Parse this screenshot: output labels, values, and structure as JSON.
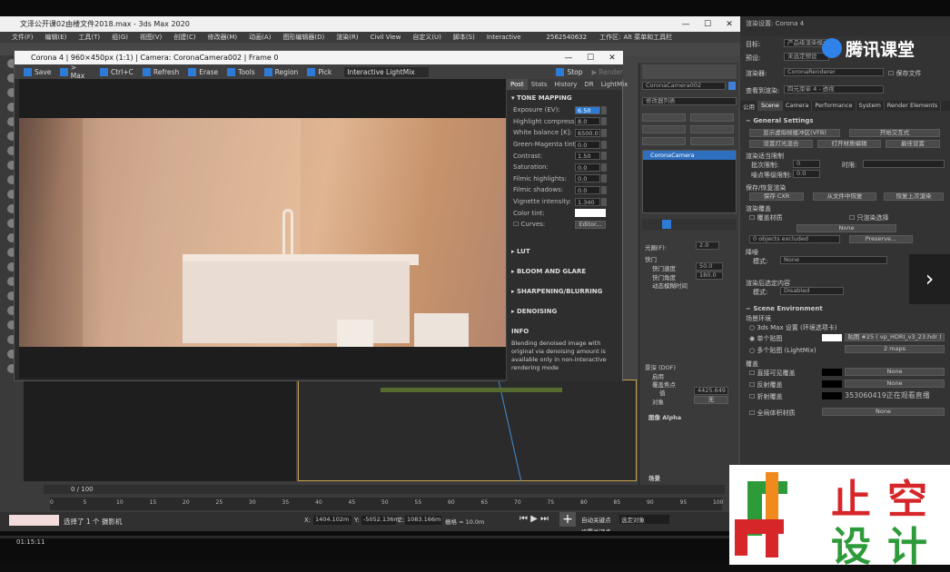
{
  "max": {
    "title": "文泽公开课02由楼文件2018.max - 3ds Max 2020",
    "menu": [
      "文件(F)",
      "编辑(E)",
      "工具(T)",
      "组(G)",
      "视图(V)",
      "创建(C)",
      "修改器(M)",
      "动画(A)",
      "图形编辑器(D)",
      "渲染(R)",
      "Civil View",
      "自定义(U)",
      "脚本(S)",
      "Interactive"
    ],
    "user": "2562540632",
    "workspace_label": "工作区:",
    "workspace_value": "Alt 菜单和工具栏",
    "time_slider": "0 / 100",
    "ticks": [
      "0",
      "5",
      "10",
      "15",
      "20",
      "25",
      "30",
      "35",
      "40",
      "45",
      "50",
      "55",
      "60",
      "65",
      "70",
      "75",
      "80",
      "85",
      "90",
      "95",
      "100"
    ],
    "status_text": "选择了 1 个 摄影机",
    "coord_x": "1404.102m",
    "coord_y": "-5052.136m",
    "coord_z": "1083.166m",
    "grid": "栅格 = 10.0m",
    "autokey": "自动关键点",
    "setkey": "设置关键点",
    "selected_object": "选定对象",
    "elapsed": "01:15:11"
  },
  "vfb": {
    "title": "Corona 4 | 960×450px (1:1) | Camera: CoronaCamera002 | Frame 0",
    "tools": [
      "Save",
      "> Max",
      "Ctrl+C",
      "Refresh",
      "Erase",
      "Tools",
      "Region",
      "Pick"
    ],
    "interactive": "Interactive LightMix",
    "stop": "Stop",
    "render": "Render",
    "tabs": [
      "Post",
      "Stats",
      "History",
      "DR",
      "LightMix"
    ],
    "tone_mapping": "TONE MAPPING",
    "params": [
      {
        "label": "Exposure (EV):",
        "value": "6.50"
      },
      {
        "label": "Highlight compress:",
        "value": "8.0"
      },
      {
        "label": "White balance [K]:",
        "value": "6500.0"
      },
      {
        "label": "Green-Magenta tint:",
        "value": "0.0"
      },
      {
        "label": "Contrast:",
        "value": "1.50"
      },
      {
        "label": "Saturation:",
        "value": "0.0"
      },
      {
        "label": "Filmic highlights:",
        "value": "0.0"
      },
      {
        "label": "Filmic shadows:",
        "value": "0.0"
      },
      {
        "label": "Vignette intensity:",
        "value": "1.340"
      }
    ],
    "color_tint": "Color tint:",
    "curves": "Curves:",
    "editor": "Editor...",
    "sections": [
      "LUT",
      "BLOOM AND GLARE",
      "SHARPENING/BLURRING",
      "DENOISING"
    ],
    "info_head": "INFO",
    "info_text": "Blending denoised image with original via denoising amount is available only in non-interactive rendering mode"
  },
  "cmd": {
    "camera_name": "CoronaCamera002",
    "modifier_list": "修改器列表",
    "list_item": "CoronaCamera",
    "fov_label": "光圈(F):",
    "fov_value": "2.0",
    "shutter": "快门",
    "shutter_speed": "快门速度",
    "shutter_speed_val": "50.0",
    "shutter_angle": "快门角度",
    "shutter_angle_val": "180.0",
    "blur_label": "动态模糊时间",
    "dof_label": "景深 (DOF)",
    "enable": "启用",
    "focus": "覆盖焦点",
    "value_label": "值",
    "value": "4425.649",
    "target": "对象",
    "none": "无",
    "image_alpha": "图像 Alpha",
    "env": "场景"
  },
  "rs": {
    "title": "渲染设置: Corona 4",
    "target_label": "目标:",
    "target": "产品级渲染模式",
    "preset_label": "预设:",
    "preset": "未选定预设",
    "renderer_label": "渲染器:",
    "renderer": "CoronaRenderer",
    "save_file": "保存文件",
    "view_label": "查看到渲染:",
    "view": "四元菜单 4 - 透视",
    "tabs": [
      "公用",
      "Scene",
      "Camera",
      "Performance",
      "System",
      "Render Elements"
    ],
    "general": "General Settings",
    "vfb_btn": "显示虚拟帧缓冲区(VFB)",
    "interactive_btn": "开始交互式",
    "lock_btn": "设置灯光混合",
    "open_btn": "打开材质编辑",
    "best_btn": "最佳设置",
    "limit": "渲染适当限制",
    "pass_limit": "批次限制:",
    "pass_val": "0",
    "time_limit": "时限:",
    "noise": "噪点等级限制:",
    "noise_val": "0.0",
    "save_load": "保存/恢复渲染",
    "save_btn": "保存 CXR",
    "resume_btn": "从文件中恢复",
    "resume2_btn": "恢复上次渲染",
    "overrides": "渲染覆盖",
    "override_mtl": "覆盖材质",
    "none": "None",
    "objects_excluded": "0 objects excluded",
    "preserve": "Preserve...",
    "render_selected": "只渲染选择",
    "denoise": "降噪",
    "mode": "模式:",
    "mode_val": "None",
    "render_only": "渲染后选定内容",
    "disabled": "Disabled",
    "env_head": "Scene Environment",
    "env_label": "场景环境",
    "max_settings": "3ds Max 设置 (环境选项卡)",
    "single_map": "单个贴图",
    "map_name": "贴图 #25 ( vp_HDRI_v3_23.hdr )",
    "multi_map": "多个贴图 (LightMix)",
    "maps_count": "2 maps",
    "override": "覆盖",
    "direct_vis": "直接可见覆盖",
    "reflect": "反射覆盖",
    "refract": "折射覆盖",
    "global_mtl": "全局体积材质",
    "watermark": "353060419正在观看直播"
  },
  "tencent": "腾讯课堂",
  "logo_text_top": "止空",
  "logo_text_bottom": "设计",
  "colors": {
    "accent": "#2e7bd6",
    "logo_red": "#d6262a",
    "logo_green": "#2e9b3a",
    "logo_orange": "#f08a1c"
  }
}
